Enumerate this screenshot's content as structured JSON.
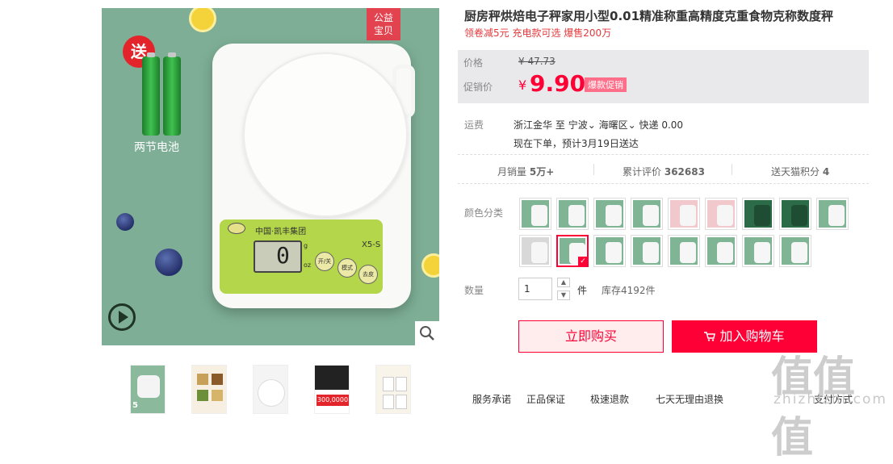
{
  "main_image": {
    "gift_badge": "送",
    "battery_caption": "两节电池",
    "charity_tag": [
      "公益",
      "宝贝"
    ],
    "scale_brand": "中国·凯丰集团",
    "scale_model": "X5-S",
    "scale_display": "0",
    "scale_unit_top": "g",
    "scale_unit_bottom": "oz",
    "scale_buttons": [
      "开/关",
      "模式",
      "去皮"
    ]
  },
  "thumbnails": [
    {
      "caption": "5"
    },
    {
      "caption": ""
    },
    {
      "caption": ""
    },
    {
      "caption": "300,0000"
    },
    {
      "caption": ""
    }
  ],
  "product": {
    "title": "厨房秤烘焙电子秤家用小型0.01精准称重高精度克重食物克称数度秤",
    "subtitle": "领卷减5元 充电款可选 爆售200万"
  },
  "price": {
    "label": "价格",
    "old_price": "¥ 47.73",
    "promo_label": "促销价",
    "currency": "¥",
    "promo_price": "9.90",
    "promo_tag": "爆款促销"
  },
  "shipping": {
    "label": "运费",
    "from": "浙江金华",
    "to_word": "至",
    "city": "宁波",
    "district": "海曙区",
    "method": "快递 0.00",
    "eta": "现在下单，预计3月19日送达"
  },
  "stats": {
    "monthly_sales_label": "月销量",
    "monthly_sales_value": "5万+",
    "reviews_label": "累计评价",
    "reviews_value": "362683",
    "points_label": "送天猫积分",
    "points_value": "4"
  },
  "color": {
    "label": "颜色分类",
    "selected_index": 10,
    "swatches": [
      "#7fb595",
      "#7fb595",
      "#7fb595",
      "#7fb595",
      "#f1c9cd",
      "#f1c9cd",
      "#2c6b47",
      "#2c6b47",
      "#7fb595",
      "#d8d8d8",
      "#7fb595",
      "#7fb595",
      "#7fb595",
      "#7fb595",
      "#7fb595",
      "#7fb595",
      "#7fb595"
    ]
  },
  "quantity": {
    "label": "数量",
    "value": "1",
    "unit": "件",
    "stock": "库存4192件"
  },
  "buttons": {
    "buy_now": "立即购买",
    "add_to_cart": "加入购物车"
  },
  "service": {
    "label": "服务承诺",
    "items": [
      "正品保证",
      "极速退款",
      "七天无理由退换",
      "支付方式"
    ]
  },
  "watermark": {
    "big": "值值值",
    "small": "zhizhizhi.com"
  },
  "colors": {
    "accent": "#ff0036",
    "image_bg": "#7eaf96"
  }
}
